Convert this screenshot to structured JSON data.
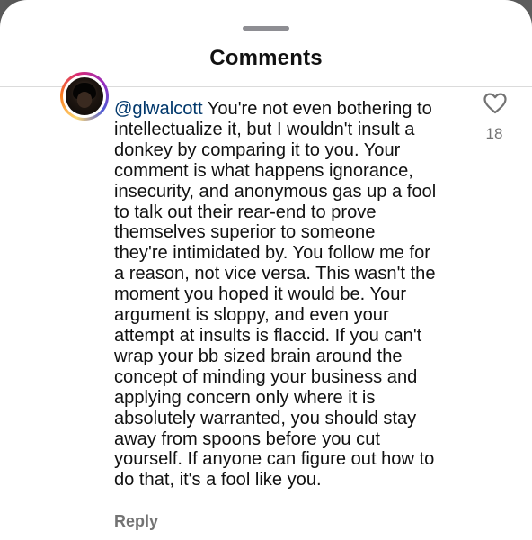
{
  "sheet": {
    "title": "Comments"
  },
  "comment": {
    "mention": "@glwalcott",
    "lines": [
      " You're not even bothering to",
      "intellectualize it, but I wouldn't insult a",
      "donkey by comparing it to you. Your",
      "comment is what happens ignorance,",
      "insecurity, and anonymous gas up a fool",
      "to talk out their rear-end to prove",
      "themselves superior to someone",
      "they're intimidated by. You follow me for",
      "a reason, not vice versa. This wasn't the",
      "moment you hoped it would be. Your",
      "argument is sloppy, and even your",
      "attempt at insults is flaccid. If you can't",
      "wrap your bb sized brain around the",
      "concept of minding your business and",
      "applying concern only where it is",
      "absolutely warranted, you should stay",
      "away from spoons before you cut",
      "yourself. If anyone can figure out how to",
      "do that, it's a fool like you."
    ],
    "like_count": "18",
    "reply_label": "Reply"
  },
  "icons": {
    "like": "heart-outline-icon",
    "grabber": "sheet-grabber"
  },
  "colors": {
    "mention": "#00376b",
    "secondary_text": "#737373",
    "story_ring_start": "#feda75",
    "story_ring_end": "#962fbf"
  }
}
